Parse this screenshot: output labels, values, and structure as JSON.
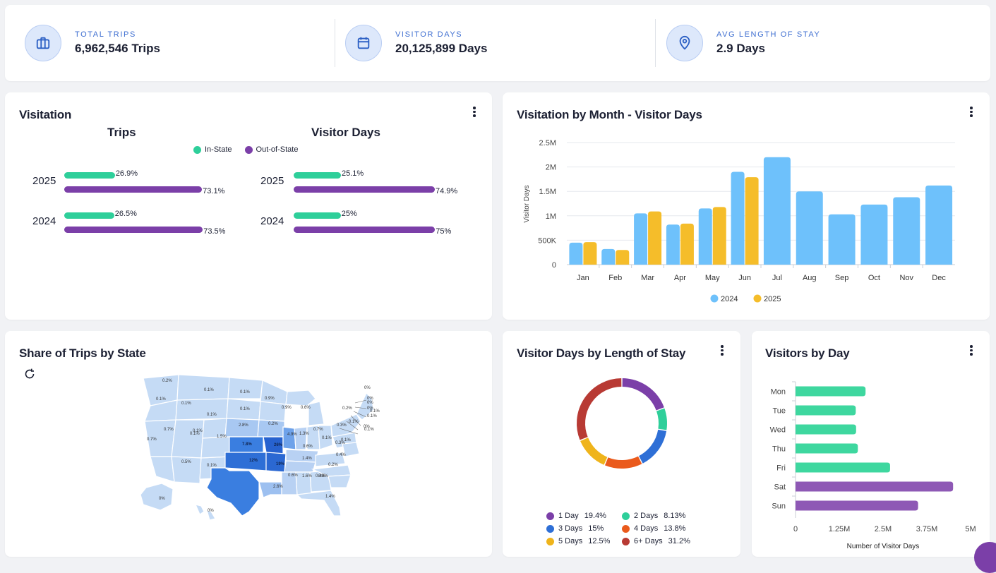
{
  "kpis": [
    {
      "label": "TOTAL TRIPS",
      "value": "6,962,546 Trips",
      "icon": "briefcase-icon"
    },
    {
      "label": "VISITOR DAYS",
      "value": "20,125,899 Days",
      "icon": "calendar-icon"
    },
    {
      "label": "AVG LENGTH OF STAY",
      "value": "2.9 Days",
      "icon": "map-pin-icon"
    }
  ],
  "visitation": {
    "title": "Visitation",
    "trips_title": "Trips",
    "days_title": "Visitor Days",
    "legend": [
      {
        "label": "In-State",
        "color": "#2ecf9a"
      },
      {
        "label": "Out-of-State",
        "color": "#7b3fa8"
      }
    ],
    "trips": [
      {
        "year": "2025",
        "in_label": "26.9%",
        "out_label": "73.1%",
        "in_value": 26.9,
        "out_value": 73.1
      },
      {
        "year": "2024",
        "in_label": "26.5%",
        "out_label": "73.5%",
        "in_value": 26.5,
        "out_value": 73.5
      }
    ],
    "days": [
      {
        "year": "2025",
        "in_label": "25.1%",
        "out_label": "74.9%",
        "in_value": 25.1,
        "out_value": 74.9
      },
      {
        "year": "2024",
        "in_label": "25%",
        "out_label": "75%",
        "in_value": 25,
        "out_value": 75
      }
    ]
  },
  "monthly": {
    "title": "Visitation by Month - Visitor Days",
    "chart_data": {
      "type": "bar",
      "categories": [
        "Jan",
        "Feb",
        "Mar",
        "Apr",
        "May",
        "Jun",
        "Jul",
        "Aug",
        "Sep",
        "Oct",
        "Nov",
        "Dec"
      ],
      "series": [
        {
          "name": "2024",
          "color": "#6ec1fb",
          "values": [
            450000,
            320000,
            1050000,
            820000,
            1150000,
            1900000,
            2200000,
            1500000,
            1030000,
            1230000,
            1380000,
            1620000
          ]
        },
        {
          "name": "2025",
          "color": "#f5bd2a",
          "values": [
            460000,
            300000,
            1090000,
            840000,
            1180000,
            1790000,
            null,
            null,
            null,
            null,
            null,
            null
          ]
        }
      ],
      "ylabel": "Visitor Days",
      "ylim": [
        0,
        2500000
      ],
      "yticks": [
        0,
        500000,
        1000000,
        1500000,
        2000000,
        2500000
      ],
      "ytick_labels": [
        "0",
        "500K",
        "1M",
        "1.5M",
        "2M",
        "2.5M"
      ],
      "grid": true,
      "legend": "bottom"
    }
  },
  "map": {
    "title": "Share of Trips by State",
    "refresh_icon": "refresh-icon",
    "labels": [
      "0.2%",
      "0.1%",
      "0.1%",
      "0.1%",
      "0.1%",
      "0.9%",
      "0.9%",
      "0.6%",
      "0.2%",
      "0%",
      "0.1%",
      "0.1%",
      "0.2%",
      "2.8%",
      "0.1%",
      "0.7%",
      "0.1%",
      "1.5%",
      "4.9%",
      "1.3%",
      "0.7%",
      "0.3%",
      "0.1%",
      "0.1%",
      "0.7%",
      "7.8%",
      "26%",
      "0.6%",
      "0.1%",
      "0.3%",
      "0.4%",
      "0.5%",
      "0.1%",
      "12%",
      "1.4%",
      "0.2%",
      "19%",
      "0.4%",
      "1.6%",
      "0.6%",
      "0.8%",
      "2.6%",
      "1.4%",
      "0%",
      "0%",
      "0%",
      "0%",
      "0%",
      "0.1%",
      "0.1%",
      "0%",
      "0.1%"
    ]
  },
  "length_of_stay": {
    "title": "Visitor Days by Length of Stay",
    "chart_data": {
      "type": "pie",
      "categories": [
        "1 Day",
        "2 Days",
        "3 Days",
        "4 Days",
        "5 Days",
        "6+ Days"
      ],
      "values": [
        19.4,
        8.13,
        15,
        13.8,
        12.5,
        31.2
      ],
      "value_labels": [
        "19.4%",
        "8.13%",
        "15%",
        "13.8%",
        "12.5%",
        "31.2%"
      ],
      "colors": [
        "#7b3fa8",
        "#2ecf9a",
        "#2e6fd6",
        "#ea5a1c",
        "#efb41b",
        "#b83a34"
      ]
    }
  },
  "visitors_by_day": {
    "title": "Visitors by Day",
    "chart_data": {
      "type": "bar",
      "orientation": "horizontal",
      "categories": [
        "Mon",
        "Tue",
        "Wed",
        "Thu",
        "Fri",
        "Sat",
        "Sun"
      ],
      "values": [
        2000000,
        1720000,
        1730000,
        1780000,
        2700000,
        4500000,
        3500000
      ],
      "colors": [
        "#3ed79f",
        "#3ed79f",
        "#3ed79f",
        "#3ed79f",
        "#3ed79f",
        "#8e58b5",
        "#8e58b5"
      ],
      "xlim": [
        0,
        5000000
      ],
      "xticks": [
        0,
        1250000,
        2500000,
        3750000,
        5000000
      ],
      "xtick_labels": [
        "0",
        "1.25M",
        "2.5M",
        "3.75M",
        "5M"
      ],
      "xlabel": "Number of Visitor Days"
    }
  }
}
